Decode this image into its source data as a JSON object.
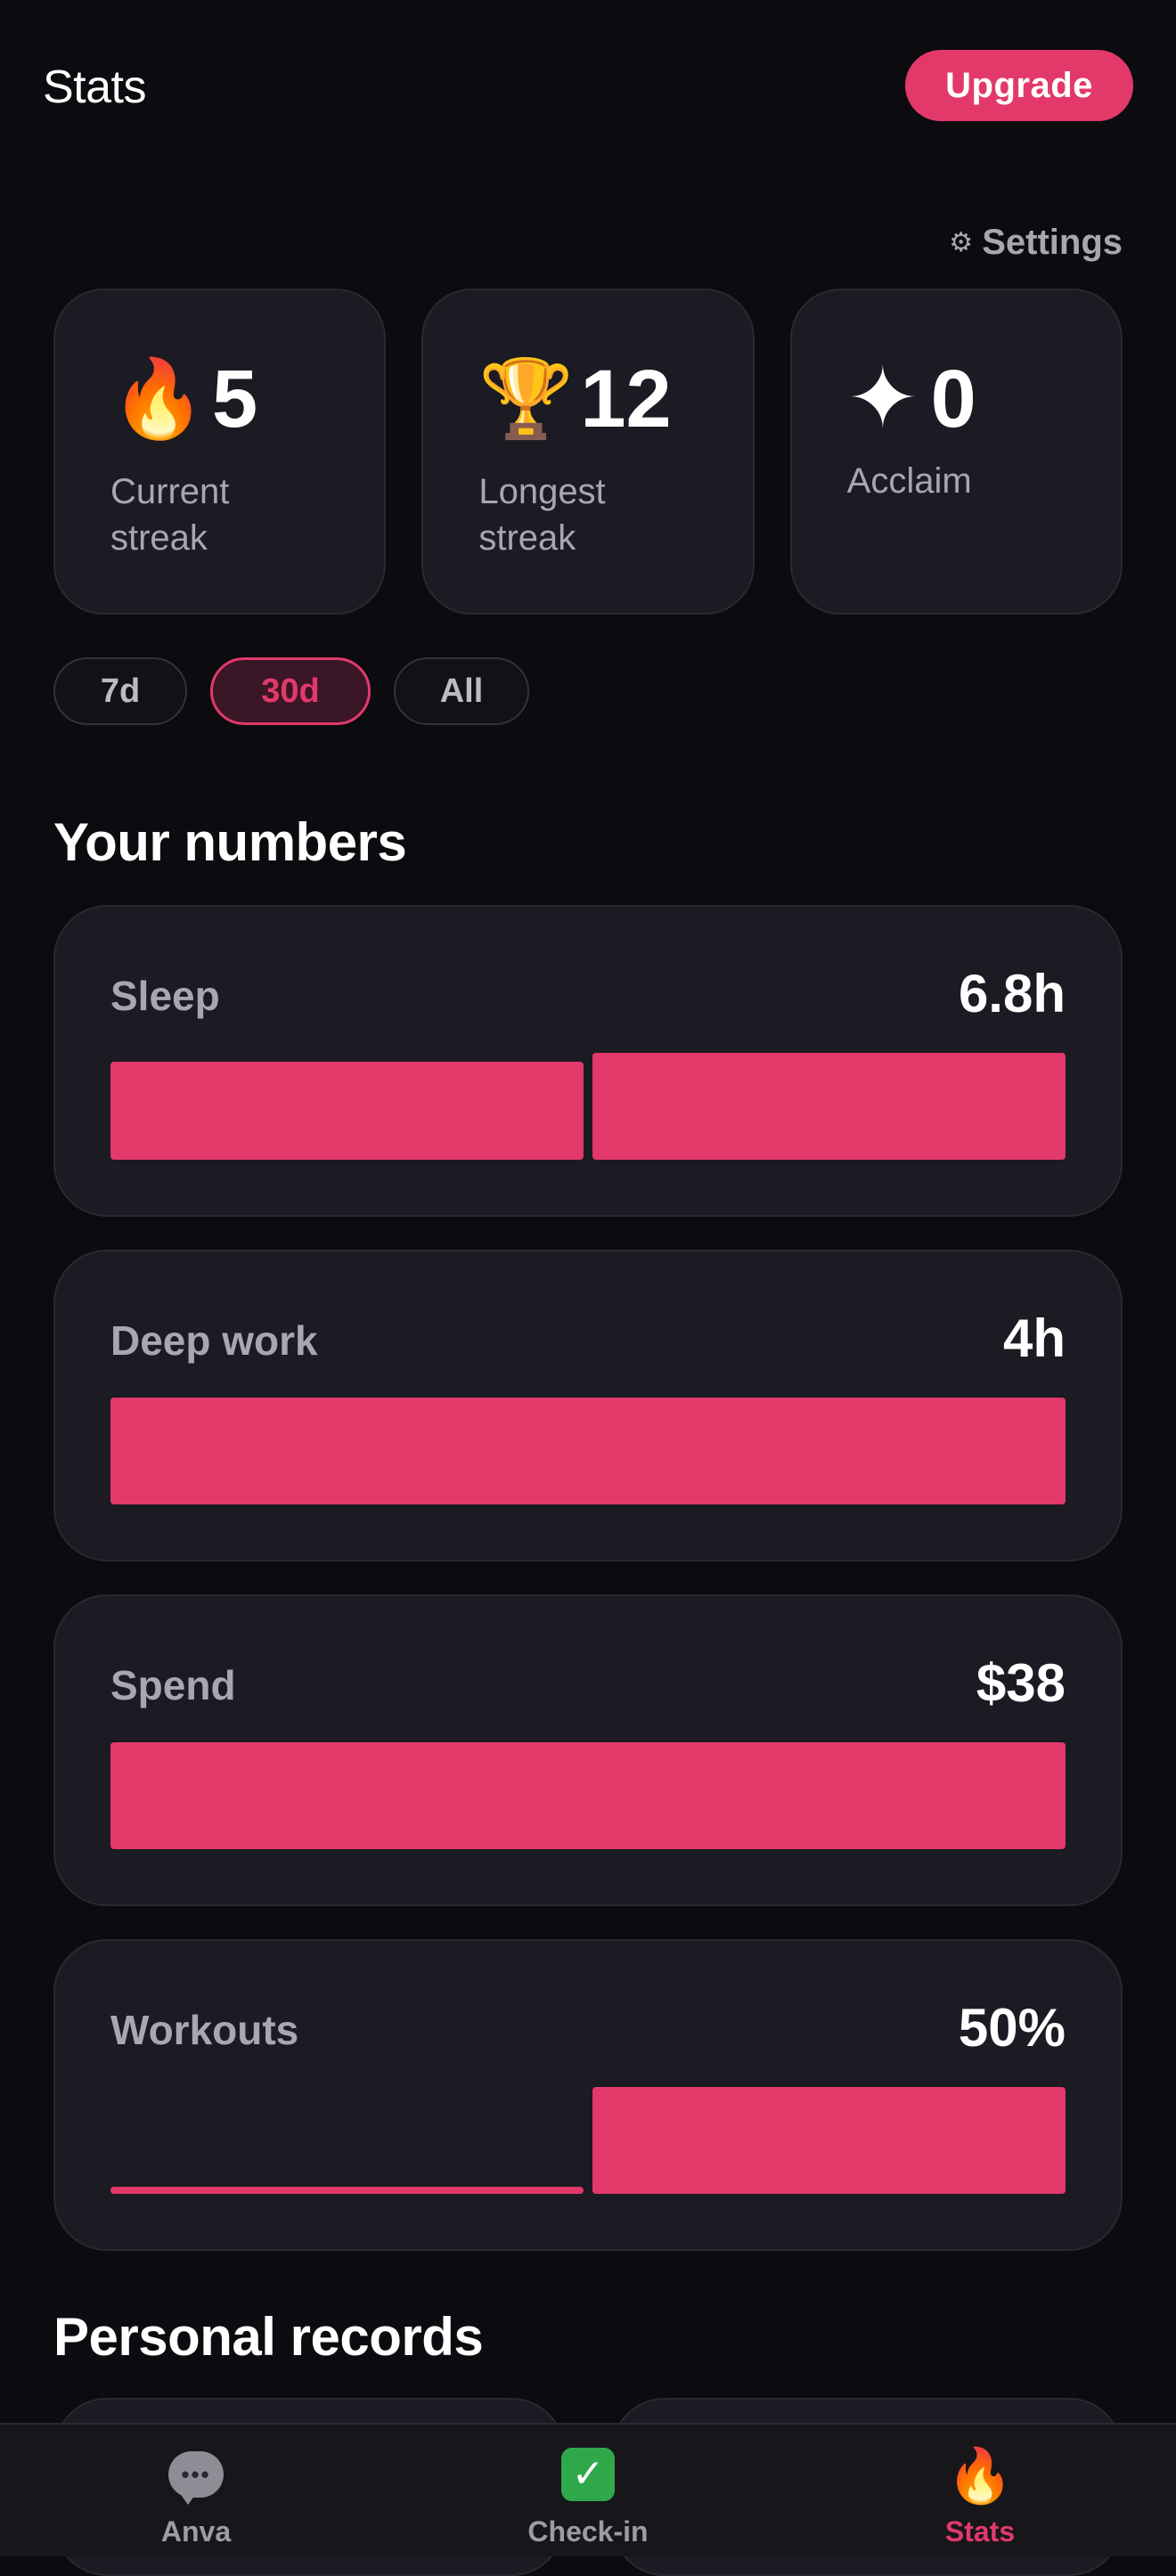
{
  "header": {
    "title": "Stats",
    "upgrade_label": "Upgrade"
  },
  "settings": {
    "label": "Settings",
    "icon": "gear-icon"
  },
  "stat_cards": [
    {
      "icon": "fire-icon",
      "value": "5",
      "label": "Current streak"
    },
    {
      "icon": "trophy-icon",
      "value": "12",
      "label": "Longest streak"
    },
    {
      "icon": "sparkle-icon",
      "value": "0",
      "label": "Acclaim"
    }
  ],
  "range_filter": {
    "options": [
      "7d",
      "30d",
      "All"
    ],
    "selected": "30d"
  },
  "numbers_section": {
    "title": "Your numbers"
  },
  "metrics": [
    {
      "label": "Sleep",
      "value": "6.8h",
      "bar_levels": [
        0.92,
        1.0
      ]
    },
    {
      "label": "Deep work",
      "value": "4h",
      "bar_levels": [
        1.0
      ]
    },
    {
      "label": "Spend",
      "value": "$38",
      "bar_levels": [
        1.0
      ]
    },
    {
      "label": "Workouts",
      "value": "50%",
      "bar_levels": [
        0.05,
        1.0
      ]
    }
  ],
  "records_section": {
    "title": "Personal records"
  },
  "tabbar": {
    "tabs": [
      {
        "label": "Anva",
        "icon": "chat-bubble-icon",
        "active": false
      },
      {
        "label": "Check-in",
        "icon": "checkmark-icon",
        "active": false
      },
      {
        "label": "Stats",
        "icon": "fire-icon",
        "active": true
      }
    ]
  },
  "colors": {
    "accent": "#e2396a",
    "background": "#0c0b0f",
    "card": "#1c1a22",
    "muted_text": "#a9a6b2"
  }
}
